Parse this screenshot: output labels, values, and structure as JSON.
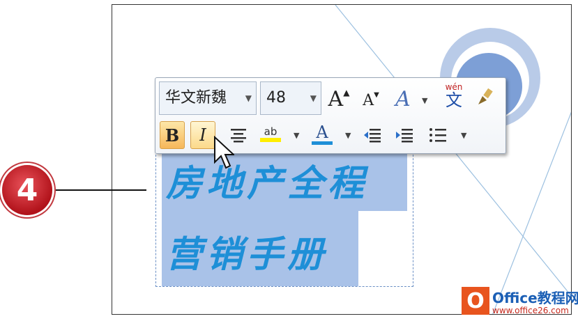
{
  "document": {
    "line1": "房地产全程",
    "line2": "营销手册"
  },
  "toolbar": {
    "font_name": "华文新魏",
    "font_size": "48",
    "grow_font_icon": "A",
    "shrink_font_icon": "A",
    "text_effect_icon": "A",
    "phonetic_top": "wén",
    "phonetic_bottom": "文",
    "bold_label": "B",
    "italic_label": "I",
    "highlight_label": "ab",
    "font_color_label": "A"
  },
  "step": {
    "number": "4"
  },
  "watermark": {
    "title": "Office教程网",
    "url": "www.office26.com",
    "icon_letter": "O"
  },
  "colors": {
    "text_blue": "#1e8fd7",
    "selection": "#a9c2e8",
    "badge_red": "#b1121a",
    "button_active": "#f6b75a"
  }
}
